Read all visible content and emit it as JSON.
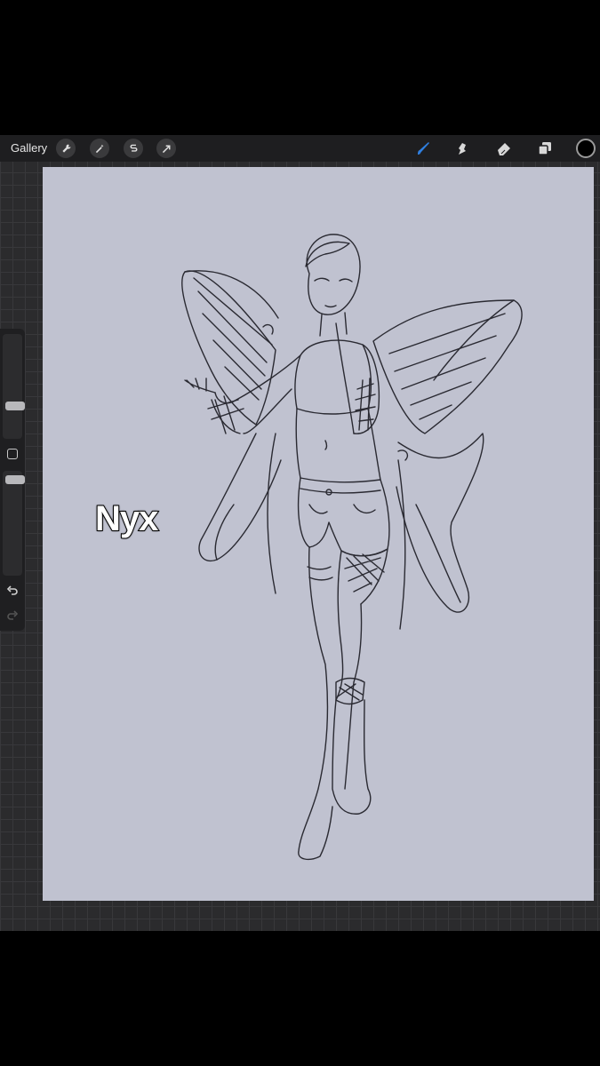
{
  "app": {
    "gallery_label": "Gallery",
    "toolbar_left": [
      {
        "name": "actions-wrench-icon"
      },
      {
        "name": "adjustments-magic-wand-icon"
      },
      {
        "name": "selection-s-icon"
      },
      {
        "name": "transform-arrow-icon"
      }
    ],
    "toolbar_right": [
      {
        "name": "brush-icon",
        "active": true
      },
      {
        "name": "smudge-icon"
      },
      {
        "name": "eraser-icon"
      },
      {
        "name": "layers-icon"
      }
    ],
    "current_color": "#000000",
    "accent_color": "#2f7fe0"
  },
  "canvas": {
    "background": "#c0c2d0",
    "overlay_text": "Nyx"
  },
  "sidebar": {
    "brush_size_level": 0.3,
    "opacity_level": 0.95
  }
}
